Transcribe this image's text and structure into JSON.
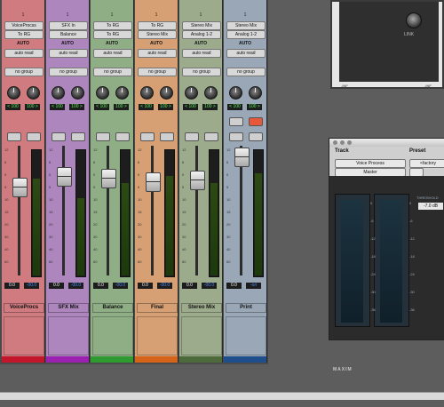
{
  "mixer": {
    "strips": [
      {
        "num": "1",
        "input": "VoiceProcss",
        "output": "To RG",
        "automation": "AUTO",
        "auto_mode": "auto read",
        "group": "no group",
        "pan_l": "< 100",
        "pan_r": "100 >",
        "volume": "0.0",
        "peak": "-00.0",
        "name": "VoiceProcs",
        "color": "#d07b80",
        "bar_color": "#c4162a"
      },
      {
        "num": "1",
        "input": "SFX In",
        "output": "Balance",
        "automation": "AUTO",
        "auto_mode": "auto read",
        "group": "no group",
        "pan_l": "< 100",
        "pan_r": "100 >",
        "volume": "0.0",
        "peak": "-00.0",
        "name": "SFX Mix",
        "color": "#ad86bd",
        "bar_color": "#9b22b0"
      },
      {
        "num": "1",
        "input": "To RG",
        "output": "To RG",
        "automation": "AUTO",
        "auto_mode": "auto read",
        "group": "no group",
        "pan_l": "< 100",
        "pan_r": "100 >",
        "volume": "0.0",
        "peak": "-00.0",
        "name": "Balance",
        "color": "#8fae86",
        "bar_color": "#2f9a2f"
      },
      {
        "num": "1",
        "input": "To RG",
        "output": "Stereo Mix",
        "automation": "AUTO",
        "auto_mode": "auto read",
        "group": "no group",
        "pan_l": "< 100",
        "pan_r": "100 >",
        "volume": "0.0",
        "peak": "-00.0",
        "name": "Final",
        "color": "#d6a074",
        "bar_color": "#d5641a"
      },
      {
        "num": "1",
        "input": "Stereo Mix",
        "output": "Analog 1-2",
        "automation": "AUTO",
        "auto_mode": "auto read",
        "group": "no group",
        "pan_l": "< 100",
        "pan_r": "100 >",
        "volume": "0.0",
        "peak": "-00.0",
        "name": "Stereo Mix",
        "color": "#9cab8c",
        "bar_color": "#4c6a3a"
      },
      {
        "num": "1",
        "input": "Stereo Mix",
        "output": "Analog 1-2",
        "automation": "AUTO",
        "auto_mode": "auto read",
        "group": "no group",
        "pan_l": "< 100",
        "pan_r": "100 >",
        "volume": "0.0",
        "peak": "-ori",
        "name": "Print",
        "color": "#9aa7b7",
        "bar_color": "#1e4f8c"
      }
    ],
    "scale_ticks": [
      "12",
      "6",
      "0",
      "5",
      "10",
      "15",
      "20",
      "30",
      "40",
      "60"
    ]
  },
  "top_window": {
    "link_label": "LINK",
    "db_left": "-INF",
    "db_right": "-INF"
  },
  "plugin": {
    "track_label": "Track",
    "preset_label": "Preset",
    "track_name": "Voice Process",
    "mode": "Master",
    "preset_value": "<factory",
    "threshold_label": "THRESHOLD",
    "threshold_value": "-7.0 dB",
    "brand": "MAXIM",
    "meter_ticks": [
      "0",
      "-6",
      "-12",
      "-18",
      "-24",
      "-30",
      "-36"
    ]
  }
}
